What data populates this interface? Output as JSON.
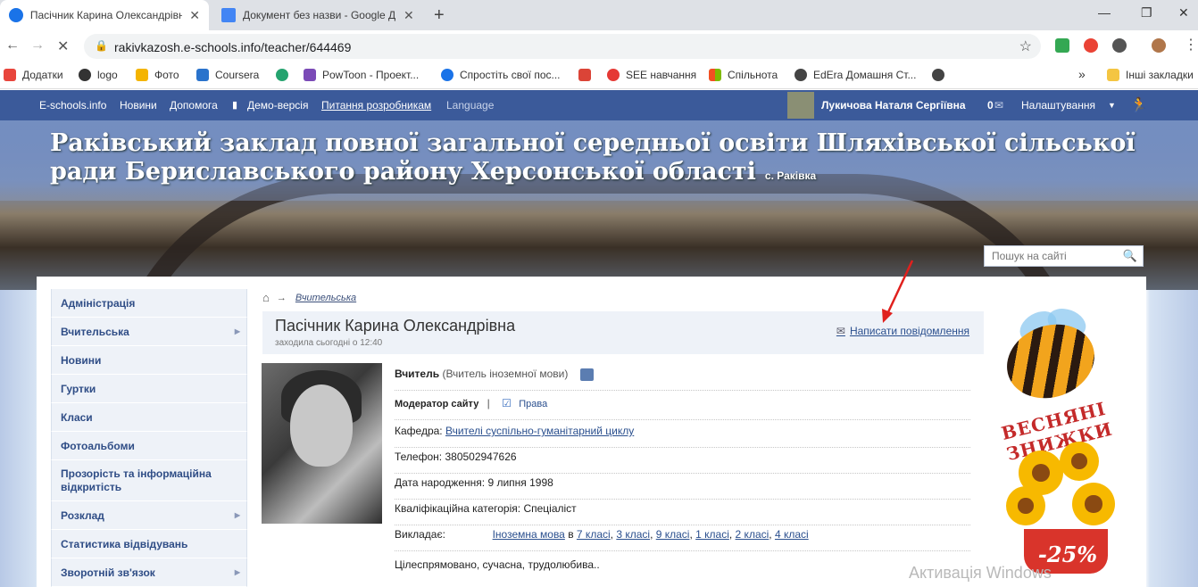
{
  "browser": {
    "tabs": [
      {
        "title": "Пасічник Карина Олександрівна",
        "active": true,
        "favicon_color": "#1a73e8"
      },
      {
        "title": "Документ без назви - Google Д",
        "active": false,
        "favicon_color": "#4285f4"
      }
    ],
    "url": "rakivkazosh.e-schools.info/teacher/644469",
    "bookmarks": [
      {
        "label": "Додатки",
        "color": "#e8453c"
      },
      {
        "label": "logo",
        "color": "#333333"
      },
      {
        "label": "Фото",
        "color": "#f4b400"
      },
      {
        "label": "Coursera",
        "color": "#2a73cc"
      },
      {
        "label": "",
        "color": "#25a36f"
      },
      {
        "label": "PowToon - Проект...",
        "color": "#7b4bb7"
      },
      {
        "label": "Спростіть свої пос...",
        "color": "#1a73e8"
      },
      {
        "label": "",
        "color": "#db4437"
      },
      {
        "label": "SEE навчання",
        "color": "#e53935"
      },
      {
        "label": "Спільнота",
        "color": "#f25022"
      },
      {
        "label": "EdEra Домашня Ст...",
        "color": "#444444"
      },
      {
        "label": "",
        "color": "#444444"
      }
    ],
    "more_bookmarks": "»",
    "other_bookmarks": "Інші закладки"
  },
  "sitenav": {
    "brand": "E-schools.info",
    "items": [
      "Новини",
      "Допомога",
      "Демо-версія",
      "Питання розробникам",
      "Language"
    ],
    "user": "Лукичова Наталя Сергіївна",
    "messages_count": "0",
    "settings": "Налаштування"
  },
  "header": {
    "school_name": "Раківський заклад повної загальної середньої освіти Шляхівської сільської ради Бериславського району Херсонської області",
    "village": "с. Раківка",
    "search_placeholder": "Пошук на сайті"
  },
  "menu": [
    {
      "label": "Адміністрація",
      "has_sub": false
    },
    {
      "label": "Вчительська",
      "has_sub": true
    },
    {
      "label": "Новини",
      "has_sub": false
    },
    {
      "label": "Гуртки",
      "has_sub": false
    },
    {
      "label": "Класи",
      "has_sub": false
    },
    {
      "label": "Фотоальбоми",
      "has_sub": false
    },
    {
      "label": "Прозорість та інформаційна відкритість",
      "has_sub": false,
      "tall": true
    },
    {
      "label": "Розклад",
      "has_sub": true
    },
    {
      "label": "Статистика відвідувань",
      "has_sub": false
    },
    {
      "label": "Зворотній зв'язок",
      "has_sub": true
    }
  ],
  "breadcrumb": {
    "current": "Вчительська"
  },
  "profile": {
    "name": "Пасічник Карина Олександрівна",
    "last_seen": "заходила сьогодні о 12:40",
    "write_message": "Написати повідомлення",
    "role": "Вчитель",
    "role_detail": "(Вчитель іноземної мови)",
    "moderator": "Модератор сайту",
    "rights": "Права",
    "department_label": "Кафедра:",
    "department": "Вчителі суспільно-гуманітарний циклу",
    "phone_label": "Телефон:",
    "phone": "380502947626",
    "birth_label": "Дата народження:",
    "birth": "9 липня 1998",
    "category_label": "Кваліфікаційна категорія:",
    "category": "Спеціаліст",
    "teaches_label": "Викладає:",
    "subject": "Іноземна мова",
    "in_word": "в",
    "classes": [
      "7 класі",
      "3 класі",
      "9 класі",
      "1 класі",
      "2 класі",
      "4 класі"
    ],
    "motto": "Цілеспрямовано, сучасна, трудолюбива.."
  },
  "ad": {
    "title": "ВЕСНЯНІ ЗНИЖКИ",
    "discount": "-25%"
  },
  "watermark": "Активація Windows"
}
